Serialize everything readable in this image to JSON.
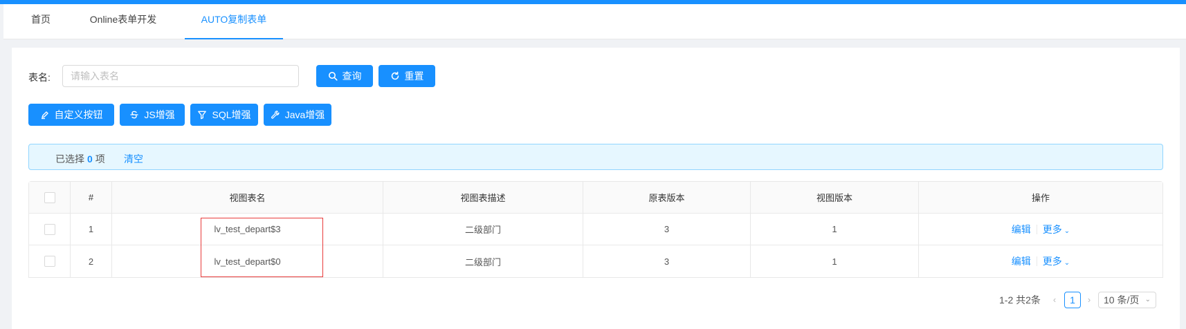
{
  "tabs": [
    {
      "label": "首页"
    },
    {
      "label": "Online表单开发"
    },
    {
      "label": "AUTO复制表单"
    }
  ],
  "search": {
    "label": "表名:",
    "placeholder": "请输入表名",
    "query_button": "查询",
    "reset_button": "重置"
  },
  "toolbar": {
    "custom_button": "自定义按钮",
    "js_button": "JS增强",
    "sql_button": "SQL增强",
    "java_button": "Java增强"
  },
  "selection": {
    "prefix": "已选择",
    "count": "0",
    "suffix": "项",
    "clear": "清空"
  },
  "table": {
    "columns": [
      "#",
      "视图表名",
      "视图表描述",
      "原表版本",
      "视图版本",
      "操作"
    ],
    "rows": [
      {
        "index": "1",
        "view_name": "lv_test_depart$3",
        "view_desc": "二级部门",
        "orig_version": "3",
        "view_version": "1",
        "edit": "编辑",
        "more": "更多"
      },
      {
        "index": "2",
        "view_name": "lv_test_depart$0",
        "view_desc": "二级部门",
        "orig_version": "3",
        "view_version": "1",
        "edit": "编辑",
        "more": "更多"
      }
    ]
  },
  "pagination": {
    "total": "1-2 共2条",
    "current_page": "1",
    "page_size": "10 条/页"
  },
  "colors": {
    "primary": "#1890ff",
    "highlight_border": "#e83a3a",
    "alert_bg": "#e6f7ff"
  }
}
